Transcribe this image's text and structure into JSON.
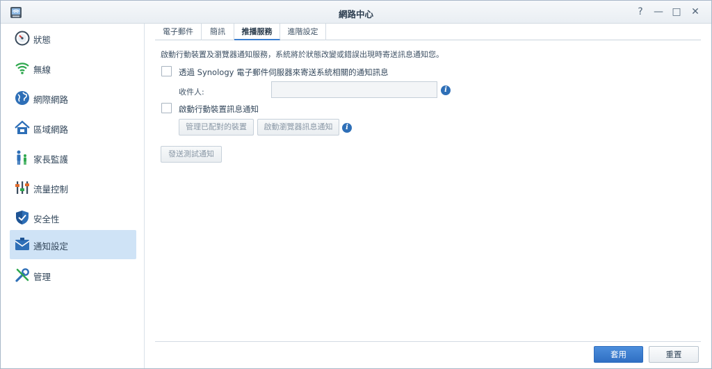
{
  "window": {
    "title": "網路中心",
    "controls": {
      "help": "?",
      "minimize": "—",
      "maximize": "□",
      "close": "✕"
    }
  },
  "sidebar": {
    "items": [
      {
        "label": "狀態",
        "icon": "gauge-icon"
      },
      {
        "label": "無線",
        "icon": "wifi-icon"
      },
      {
        "label": "網際網路",
        "icon": "globe-icon"
      },
      {
        "label": "區域網路",
        "icon": "home-network-icon"
      },
      {
        "label": "家長監護",
        "icon": "family-icon"
      },
      {
        "label": "流量控制",
        "icon": "sliders-icon"
      },
      {
        "label": "安全性",
        "icon": "shield-icon"
      },
      {
        "label": "通知設定",
        "icon": "notification-envelope-icon",
        "active": true
      },
      {
        "label": "管理",
        "icon": "tools-icon"
      }
    ]
  },
  "tabs": [
    {
      "label": "電子郵件"
    },
    {
      "label": "簡訊"
    },
    {
      "label": "推播服務",
      "active": true
    },
    {
      "label": "進階設定"
    }
  ],
  "push": {
    "description": "啟動行動裝置及瀏覽器通知服務，系統將於狀態改變或錯誤出現時寄送訊息通知您。",
    "email_checkbox_label": "透過 Synology 電子郵件伺服器來寄送系統相關的通知訊息",
    "recipient_label": "收件人:",
    "recipient_value": "",
    "mobile_checkbox_label": "啟動行動裝置訊息通知",
    "manage_devices_button": "管理已配對的裝置",
    "browser_notify_button": "啟動瀏覽器訊息通知",
    "send_test_button": "發送測試通知",
    "info_glyph": "i"
  },
  "footer": {
    "apply_button": "套用",
    "reset_button": "重置"
  },
  "colors": {
    "accent": "#3c7fcf",
    "active_sidebar": "#cfe3f6",
    "info_icon": "#2e6fb7"
  }
}
